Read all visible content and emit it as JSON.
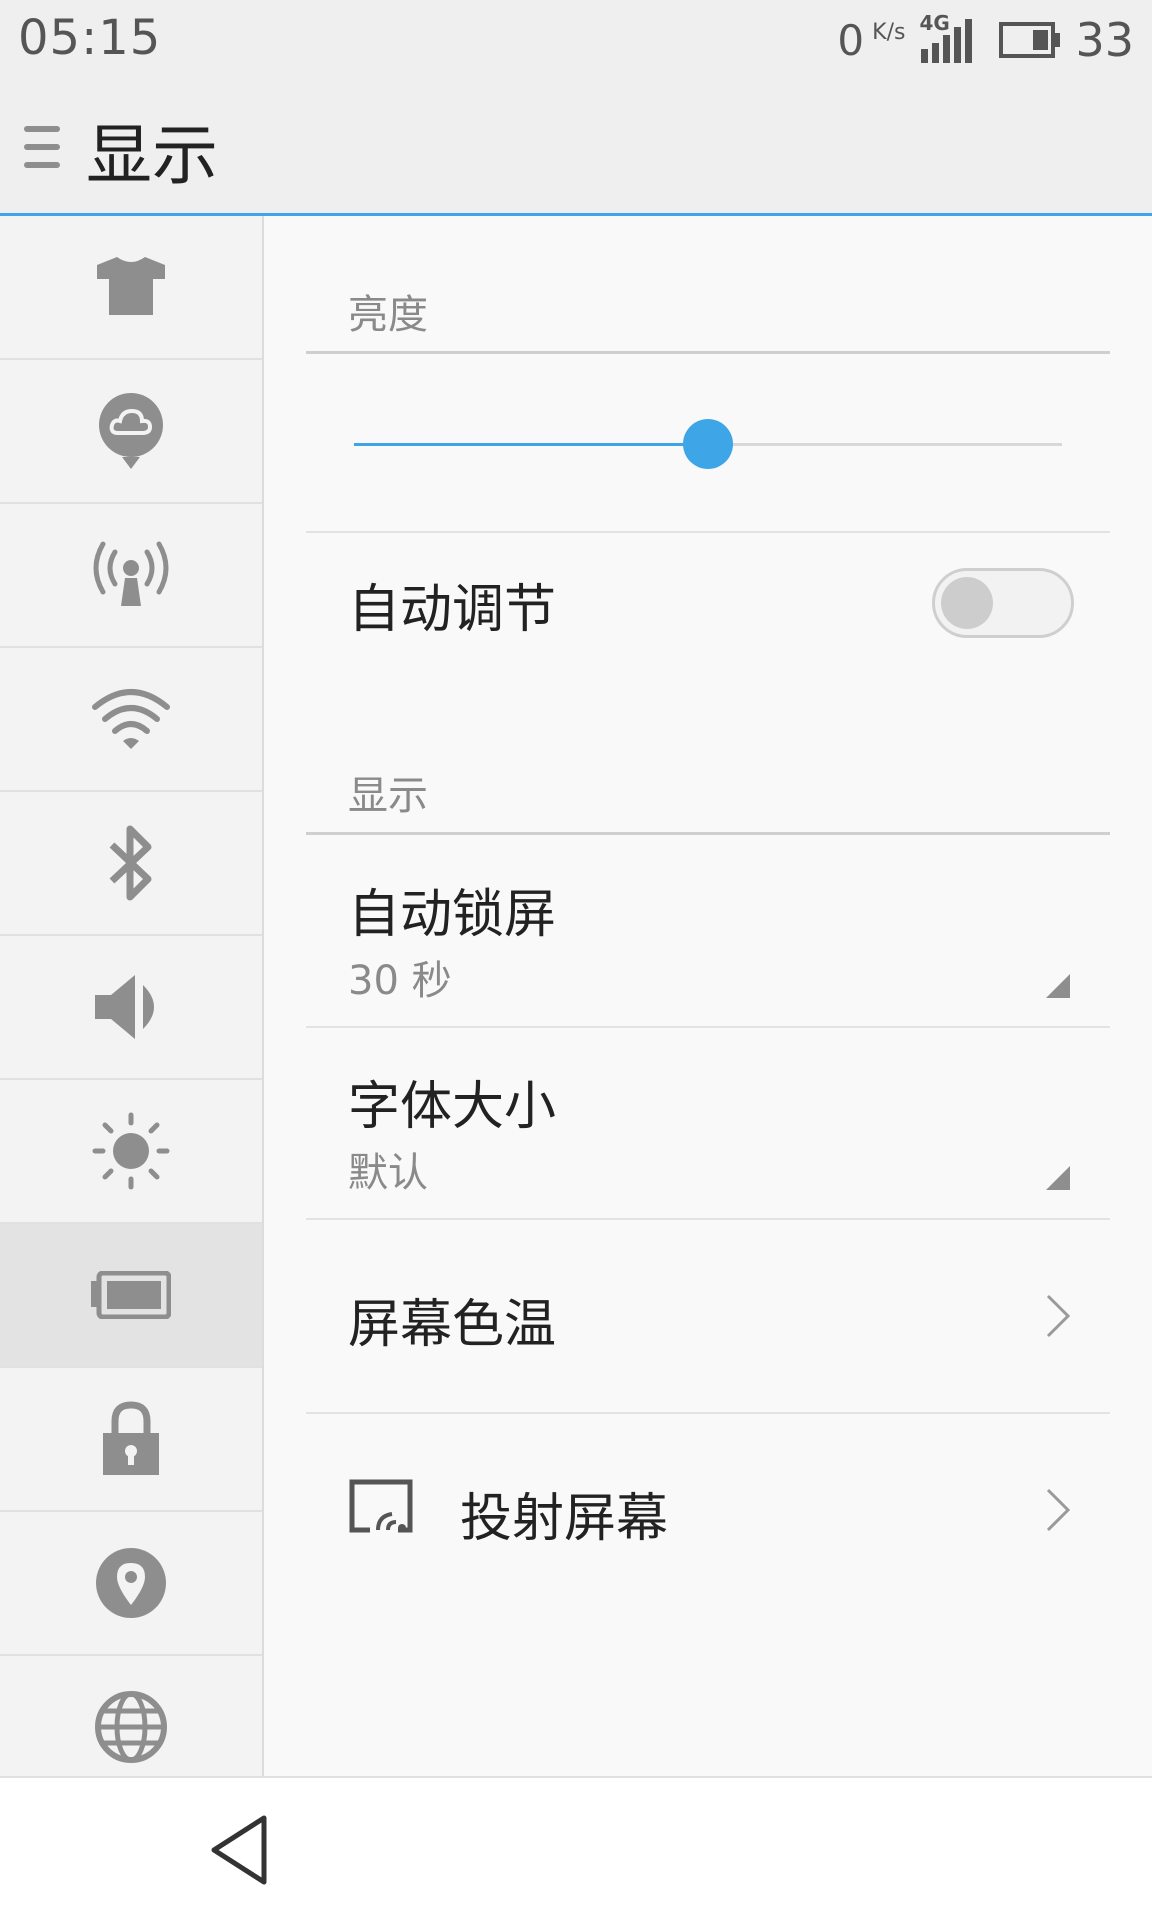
{
  "status": {
    "time": "05:15",
    "net_speed": "0",
    "net_unit": "K/s",
    "network_type": "4G",
    "battery_percent": "33"
  },
  "header": {
    "title": "显示"
  },
  "sidebar": {
    "items": [
      {
        "icon": "tshirt-icon"
      },
      {
        "icon": "cloud-icon"
      },
      {
        "icon": "hotspot-icon"
      },
      {
        "icon": "wifi-icon"
      },
      {
        "icon": "bluetooth-icon"
      },
      {
        "icon": "speaker-icon"
      },
      {
        "icon": "brightness-icon"
      },
      {
        "icon": "battery-icon",
        "active": true
      },
      {
        "icon": "lock-icon"
      },
      {
        "icon": "location-icon"
      },
      {
        "icon": "globe-icon"
      }
    ]
  },
  "brightness": {
    "section_label": "亮度",
    "level": 0.5
  },
  "auto_adjust": {
    "label": "自动调节",
    "enabled": false
  },
  "display": {
    "section_label": "显示",
    "auto_lock": {
      "label": "自动锁屏",
      "value": "30 秒"
    },
    "font_size": {
      "label": "字体大小",
      "value": "默认"
    },
    "color_temp": {
      "label": "屏幕色温"
    },
    "cast_screen": {
      "label": "投射屏幕"
    }
  },
  "colors": {
    "accent": "#3ea6e6",
    "icon_gray": "#8e8e8e"
  }
}
